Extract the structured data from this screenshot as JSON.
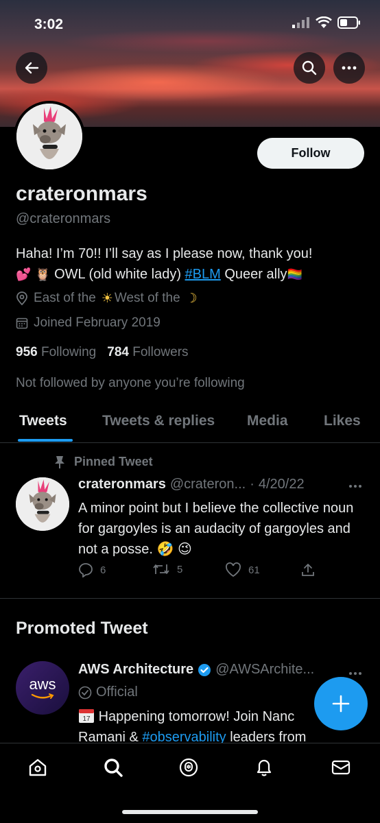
{
  "status_bar": {
    "time": "3:02"
  },
  "profile": {
    "follow_label": "Follow",
    "display_name": "crateronmars",
    "handle": "@crateronmars",
    "bio_line1": "Haha! I’m 70!! I’ll say as I please now, thank you!",
    "bio_emoji1": "💕 🦉",
    "bio_owl_text": "OWL (old white lady)",
    "bio_hashtag": "#BLM",
    "bio_queer": "Queer ally",
    "bio_flag": "🏳️‍🌈",
    "location_prefix": "East of the",
    "location_sun": "☀",
    "location_middle": "West of the",
    "location_moon": "☽",
    "joined": "Joined February 2019",
    "following_count": "956",
    "following_label": "Following",
    "followers_count": "784",
    "followers_label": "Followers",
    "not_followed": "Not followed by anyone you’re following"
  },
  "tabs": [
    {
      "label": "Tweets"
    },
    {
      "label": "Tweets & replies"
    },
    {
      "label": "Media"
    },
    {
      "label": "Likes"
    }
  ],
  "pinned_tweet": {
    "pinned_label": "Pinned Tweet",
    "name": "crateronmars",
    "handle": "@crateron...",
    "separator": "·",
    "date": "4/20/22",
    "text": "A minor point but I believe the collective noun for gargoyles is an audacity of gargoyles and not a posse. 🤣 😉",
    "replies": "6",
    "retweets": "5",
    "likes": "61"
  },
  "promoted": {
    "section_title": "Promoted Tweet",
    "avatar_text": "aws",
    "name": "AWS Architecture",
    "handle": "@AWSArchite...",
    "official_label": "Official",
    "text_line1": "Happening tomorrow! Join Nanc",
    "text_line2_prefix": "Ramani & ",
    "text_hashtag": "#observability",
    "text_line2_suffix": " leaders from"
  },
  "colors": {
    "accent": "#1d9bf0",
    "background": "#000000",
    "muted": "#71767b"
  }
}
